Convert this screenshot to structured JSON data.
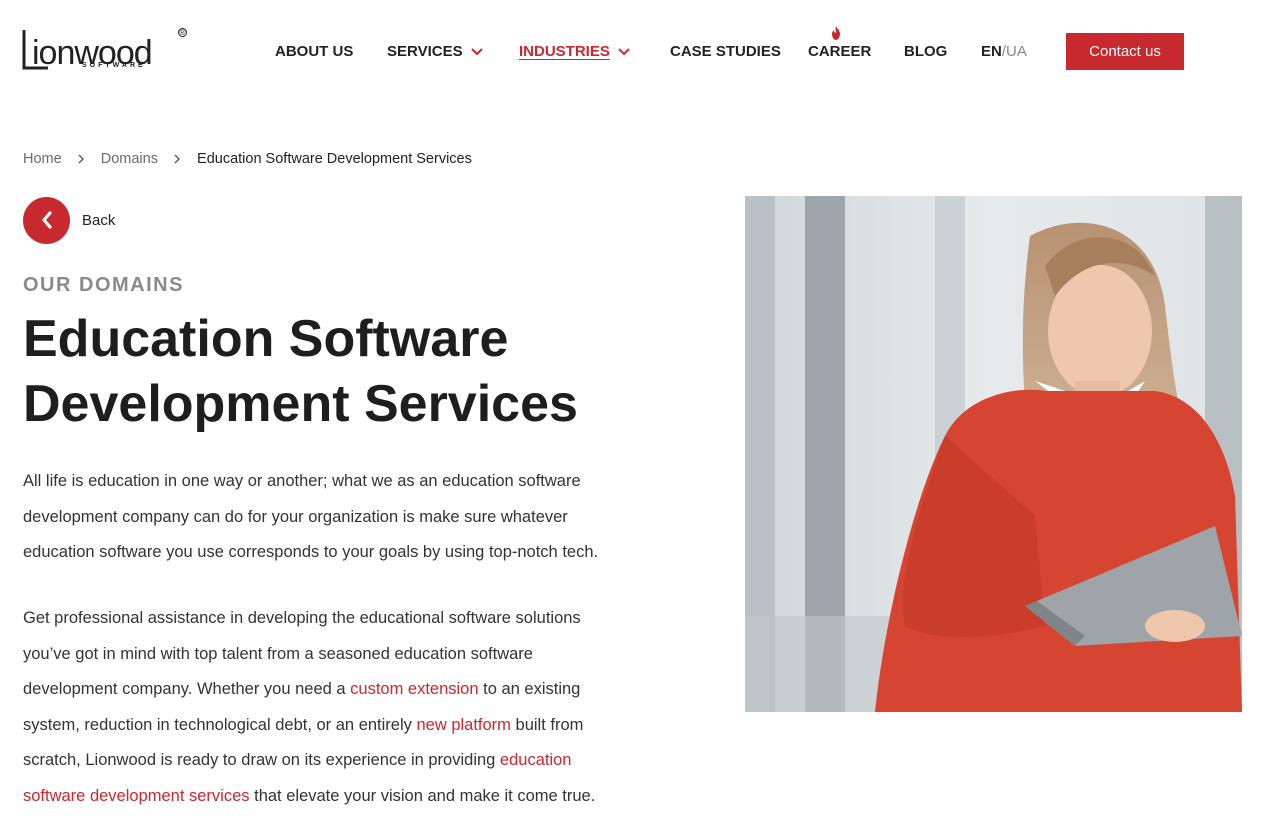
{
  "brand": {
    "name": "LIONWOOD",
    "sub": "SOFTWARE",
    "reg": "®",
    "accent": "#c8292f"
  },
  "nav": {
    "items": [
      {
        "label": "ABOUT US"
      },
      {
        "label": "SERVICES"
      },
      {
        "label": "INDUSTRIES"
      },
      {
        "label": "CASE STUDIES"
      },
      {
        "label": "CAREER"
      },
      {
        "label": "BLOG"
      }
    ],
    "lang_en": "EN",
    "lang_sep": "/",
    "lang_ua": "UA",
    "contact_label": "Contact us"
  },
  "breadcrumb": {
    "home": "Home",
    "domains": "Domains",
    "current": "Education Software Development Services"
  },
  "back_label": "Back",
  "eyebrow": "OUR DOMAINS",
  "title_line1": "Education Software",
  "title_line2": "Development Services",
  "paragraph1": "All life is education in one way or another; what we as an education software development company can do for your organization is make sure whatever education software you use corresponds to your goals by using top-notch tech.",
  "paragraph2": {
    "part1": "Get professional assistance in developing the educational software solutions you’ve got in mind with top talent from a seasoned education software development company. Whether you need a ",
    "link1": "custom extension",
    "part2": " to an existing system, reduction in technological debt, or an entirely ",
    "link2": "new platform",
    "part3": " built from scratch, Lionwood is ready to draw on its experience in providing ",
    "link3": "education software development services",
    "part4": " that elevate your vision and make it come true."
  }
}
